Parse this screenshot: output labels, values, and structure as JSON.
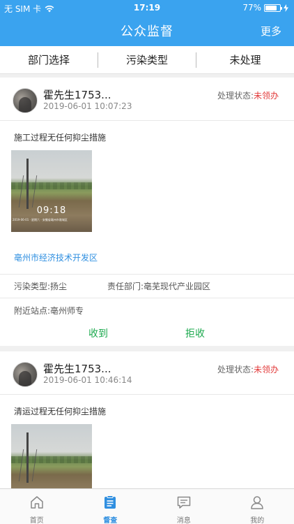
{
  "status_bar": {
    "carrier": "无 SIM 卡",
    "time": "17:19",
    "battery": "77%"
  },
  "nav": {
    "title": "公众监督",
    "more": "更多"
  },
  "filters": [
    "部门选择",
    "污染类型",
    "未处理"
  ],
  "posts": [
    {
      "user": "霍先生1753...",
      "time": "2019-06-01 10:07:23",
      "status_label": "处理状态:",
      "status_value": "未领办",
      "description": "施工过程无任何抑尘措施",
      "photo_time": "09:18",
      "photo_caption": "2019-06-01 · 星期六 · 安徽省亳州市谯城区",
      "location": "亳州市经济技术开发区",
      "pollution_type": "污染类型:扬尘",
      "department": "责任部门:亳芜现代产业园区",
      "station": "附近站点:亳州师专",
      "action_receive": "收到",
      "action_reject": "拒收"
    },
    {
      "user": "霍先生1753...",
      "time": "2019-06-01 10:46:14",
      "status_label": "处理状态:",
      "status_value": "未领办",
      "description": "清运过程无任何抑尘措施"
    }
  ],
  "tabs": [
    {
      "label": "首页",
      "icon": "home-icon",
      "active": false
    },
    {
      "label": "督查",
      "icon": "inspection-icon",
      "active": true
    },
    {
      "label": "消息",
      "icon": "message-icon",
      "active": false
    },
    {
      "label": "我的",
      "icon": "profile-icon",
      "active": false
    }
  ],
  "colors": {
    "primary": "#3aa3ef",
    "status_red": "#e23b3b",
    "action_green": "#1ca94e",
    "link_blue": "#2f8fe0"
  }
}
